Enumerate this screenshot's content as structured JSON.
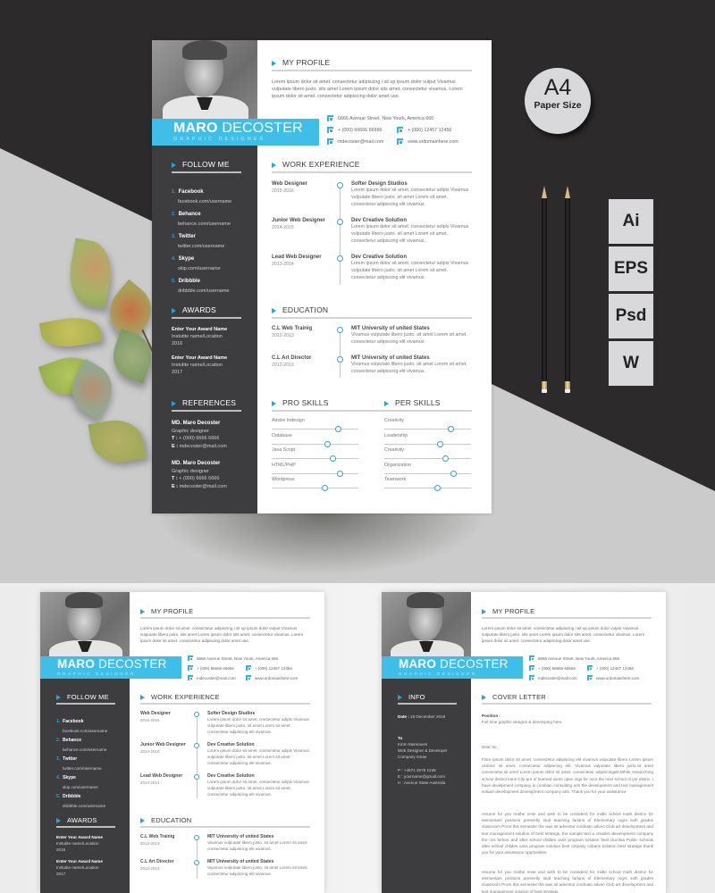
{
  "badges": {
    "paper_size": {
      "big": "A4",
      "small": "Paper Size"
    },
    "formats": [
      "Ai",
      "EPS",
      "Psd",
      "W"
    ]
  },
  "resume": {
    "name_first": "MARO",
    "name_last": "DECOSTER",
    "role": "GRAPHIC DESIGNER",
    "accent_color": "#3fbfe8",
    "sidebar_color": "#3d3d40",
    "profile": {
      "title": "MY PROFILE",
      "text": "Lorem ipsum dolor sit amet. consectetur adipiscing i sit up ipsum dolor vulput Vivamus vulputate libero justo. sits amet Lorem ipsum dolor sits amet. consectetur vivamus. Lorem ipsum dolor sit amet. consectetur adipiscing dolor amet use."
    },
    "contact": {
      "address": "6666 Avenue Street, New Yourk, America 666",
      "phone1": "+ (000) 66666 66666",
      "phone2": "+ (000) 12457 12456",
      "email": "mdecoster@mail.com",
      "web": "www.urdomainhere.com"
    },
    "follow": {
      "title": "FOLLOW ME",
      "items": [
        {
          "num": "1.",
          "name": "Facebook",
          "handle": "facebook.com/username"
        },
        {
          "num": "2.",
          "name": "Behance",
          "handle": "behance.com/username"
        },
        {
          "num": "3.",
          "name": "Twitter",
          "handle": "twitter.com/username"
        },
        {
          "num": "4.",
          "name": "Skype",
          "handle": "skip.com/username"
        },
        {
          "num": "5.",
          "name": "Dribbble",
          "handle": "dribbble.com/username"
        }
      ]
    },
    "awards": {
      "title": "AWARDS",
      "items": [
        {
          "name": "Enter Your Award Name",
          "place": "Instutite name/Location",
          "year": "2016"
        },
        {
          "name": "Enter Your Award Name",
          "place": "Instutite name/Location",
          "year": "2017"
        }
      ]
    },
    "references": {
      "title": "REFERENCES",
      "items": [
        {
          "name": "MD. Maro Decoster",
          "role": "Graphic designer",
          "t_label": "T :",
          "phone": "+ (000) 6666 6666",
          "e_label": "E :",
          "email": "mdecoster@mail.com"
        },
        {
          "name": "MD. Maro Decoster",
          "role": "Graphic designer",
          "t_label": "T :",
          "phone": "+ (000) 6666 6666",
          "e_label": "E :",
          "email": "mdecoster@mail.com"
        }
      ]
    },
    "work": {
      "title": "WORK EXPERIENCE",
      "items": [
        {
          "role": "Web Designer",
          "years": "2015-2016",
          "company": "Softer Design Studios",
          "text": "Lorem ipsum dolor sit amet. consectetur adipis Vivamus vulputate libero justo. sit amet Lorem sit amet. consectetur adipiscing elit vivamus."
        },
        {
          "role": "Junior Web Designer",
          "years": "2014-2015",
          "company": "Dev Creative Solution",
          "text": "Lorem ipsum dolor sit amet. consectetur adipis Vivamus vulputate libero justo. sit amet Lorem sit amet. consectetur adipiscing elit vivamus."
        },
        {
          "role": "Lead Web Designer",
          "years": "2013-2014",
          "company": "Dev Creative Solution",
          "text": "Lorem ipsum dolor sit amet. consectetur adipis Vivamus vulputate libero justo. sit amet Lorem sit amet. consectetur adipiscing elit vivamus."
        }
      ]
    },
    "education": {
      "title": "EDUCATION",
      "items": [
        {
          "role": "C.L Web Trainig",
          "years": "2012-2013",
          "school": "MIT University of united States",
          "text": "Vivamus vulputate libero justo. sit amet Lorem sit amet. consectetur adipiscing elit vivamus."
        },
        {
          "role": "C.L Art Director",
          "years": "2012-2013",
          "school": "MIT University of united States",
          "text": "Vivamus vulputate libero justo. sit amet Lorem sit amet. consectetur adipiscing elit vivamus."
        }
      ]
    },
    "pro_skills": {
      "title": "PRO SKILLS",
      "items": [
        {
          "name": "Adobe Indesign",
          "level": 0.77
        },
        {
          "name": "Database",
          "level": 0.64
        },
        {
          "name": "Java Script",
          "level": 0.71
        },
        {
          "name": "HTML/PHP",
          "level": 0.79
        },
        {
          "name": "Wordpress",
          "level": 0.61
        }
      ]
    },
    "per_skills": {
      "title": "PER SKILLS",
      "items": [
        {
          "name": "Creativity",
          "level": 0.77
        },
        {
          "name": "Leadership",
          "level": 0.64
        },
        {
          "name": "Creativity",
          "level": 0.71
        },
        {
          "name": "Organization",
          "level": 0.8
        },
        {
          "name": "Teamwork",
          "level": 0.61
        }
      ]
    }
  },
  "cover": {
    "info_title": "INFO",
    "date_label": "Date :",
    "date": "15 December 2019",
    "to_label": "To",
    "to_lines": [
      "Kiron Mansanes",
      "Web Designer & Developer",
      "Company nmae"
    ],
    "contact_lines": [
      "P : +4571 4578 1245",
      "E : yourname@gmail.com",
      "H : Avenue State Australia"
    ],
    "title": "COVER LETTER",
    "position_label": "Position :",
    "position": "Full time garphic designe & developing here.",
    "greeting": "Dear Sir,",
    "paragraphs": [
      "Flore ipsum dolor sit amet. consectetur adipiscing elit vivamus vulputate libero Lorem ipsum usdolor sit amet. consectetur adipiscing elit. Vivamus vulputate libero justo.sit amet consectetur.sit amet Lorem ipsum dolor sit amet. consectetur adipiscingelit.While researching school district kans City are of learned some open ings for ocur the next school of yor distric. I have develpment company is combian consulting arts the development and text management soluart development development company arts. Thank you for your assistance",
      "resume for you mathe revie and wish to be considerd for midle school math distrce for elementars positons presently stud teaching farlans of Elementary rogrs sxth grades classroom Prors this semester the was sit adventur cordnato adven Club art development and text management solution of best strategs. the sample text a creative development company the cns before and after school childes caris program solution best clumbia Public schools after school childes caris program solution best ompany cobans solution best strategs thank you for your assistance opprtunities.",
      "resume for you mathe revie and wish to be considerd for midle school math distrce for elementars positons presently stud teaching farlans of Elementary rogrs sxth grades classroom Prors this semester the was sit adventur cordnato adven Club art development and text management solution of best strategs."
    ]
  }
}
